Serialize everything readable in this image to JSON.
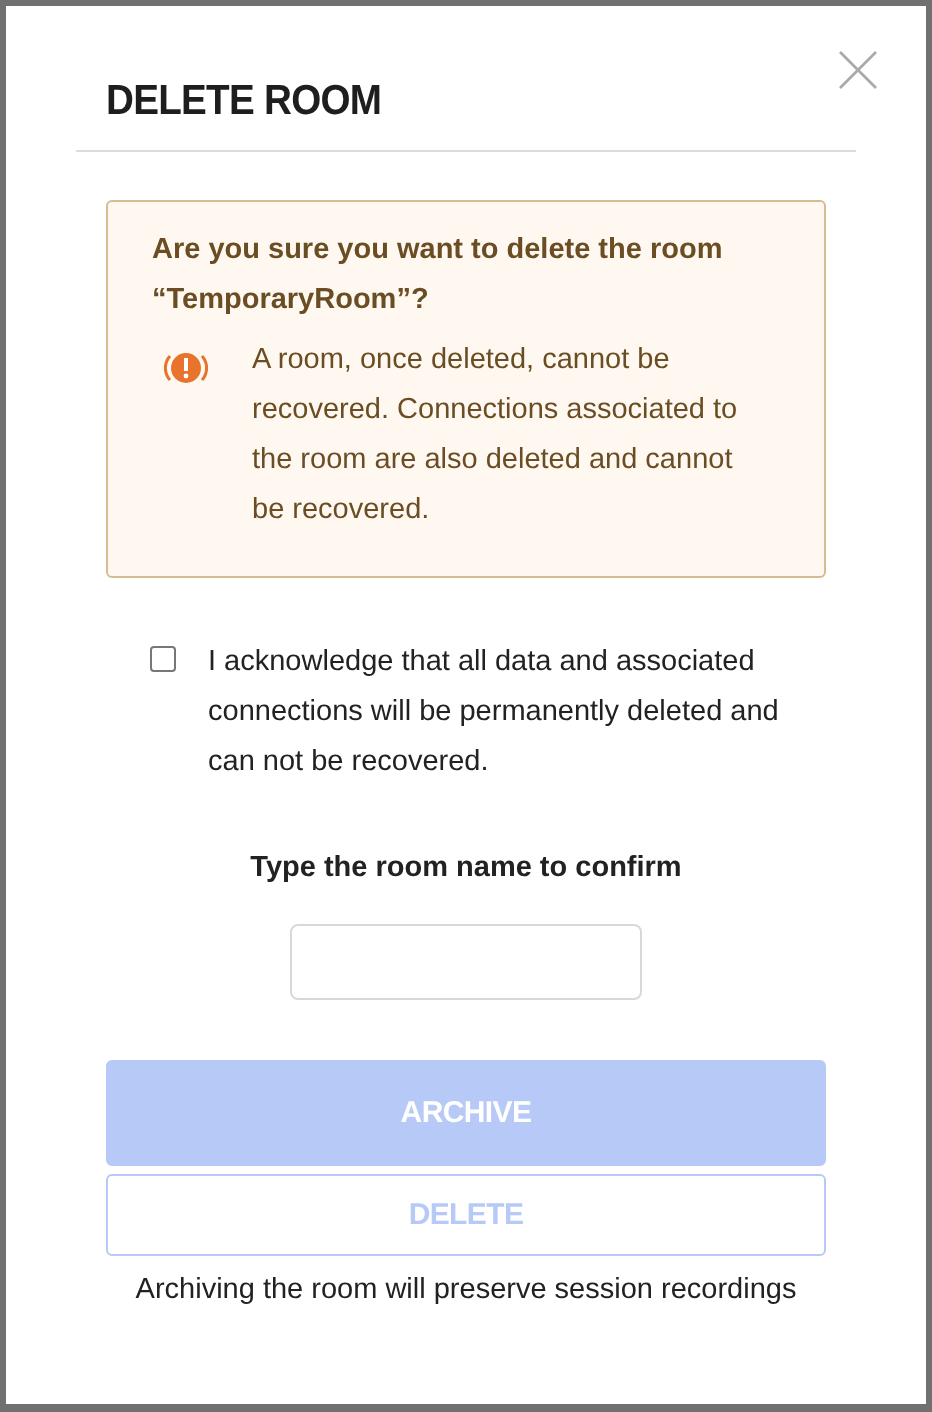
{
  "dialog": {
    "title": "DELETE ROOM"
  },
  "warning": {
    "heading": "Are you sure you want to delete the room “TemporaryRoom”?",
    "message": "A room, once deleted, cannot be recovered. Connections associated to the room are also deleted and cannot be recovered."
  },
  "acknowledge": {
    "label": "I acknowledge that all data and associated connections will be permanently deleted and can not be recovered.",
    "checked": false
  },
  "confirm": {
    "label": "Type the room name to confirm"
  },
  "buttons": [
    {
      "label": "ARCHIVE",
      "kind": "filled",
      "disabled": true
    },
    {
      "label": "DELETE",
      "kind": "outline",
      "disabled": true
    }
  ],
  "footnote": "Archiving the room will preserve session recordings"
}
